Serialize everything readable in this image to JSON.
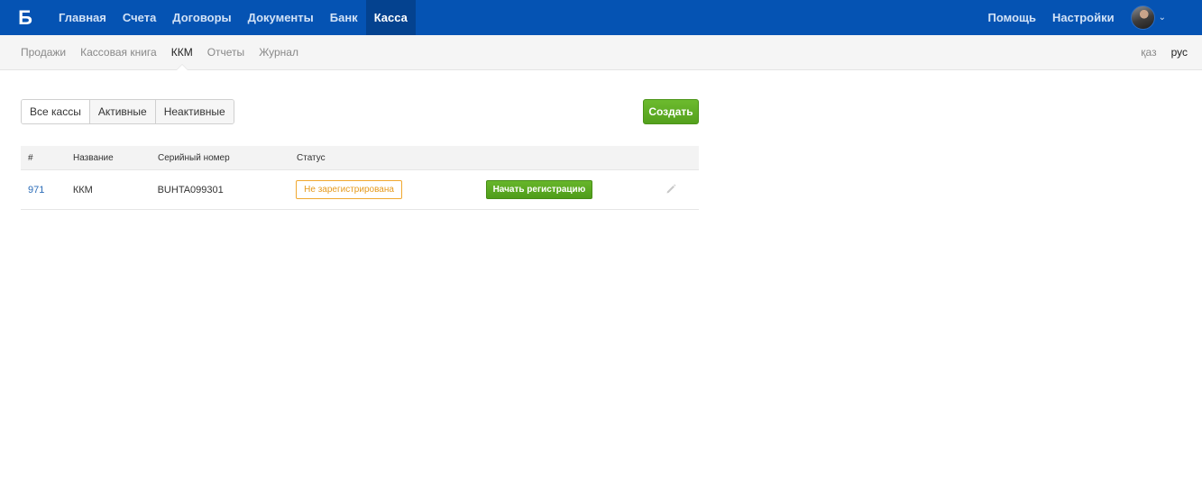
{
  "header": {
    "logo": "Б",
    "nav": [
      "Главная",
      "Счета",
      "Договоры",
      "Документы",
      "Банк",
      "Касса"
    ],
    "active_nav": "Касса",
    "help": "Помощь",
    "settings": "Настройки"
  },
  "subnav": {
    "items": [
      "Продажи",
      "Кассовая книга",
      "ККМ",
      "Отчеты",
      "Журнал"
    ],
    "active": "ККМ",
    "lang": [
      "қаз",
      "рус"
    ],
    "active_lang": "рус"
  },
  "filters": [
    "Все кассы",
    "Активные",
    "Неактивные"
  ],
  "create_label": "Создать",
  "table": {
    "headers": [
      "#",
      "Название",
      "Серийный номер",
      "Статус"
    ],
    "rows": [
      {
        "id": "971",
        "name": "ККМ",
        "serial": "BUHTA099301",
        "status": "Не зарегистрирована",
        "action": "Начать регистрацию"
      }
    ]
  },
  "colors": {
    "topbar": "#0553b3",
    "active_nav": "#04428f",
    "green": "#5aa822",
    "status_warning": "#f0a830",
    "link": "#2b6cb8"
  }
}
